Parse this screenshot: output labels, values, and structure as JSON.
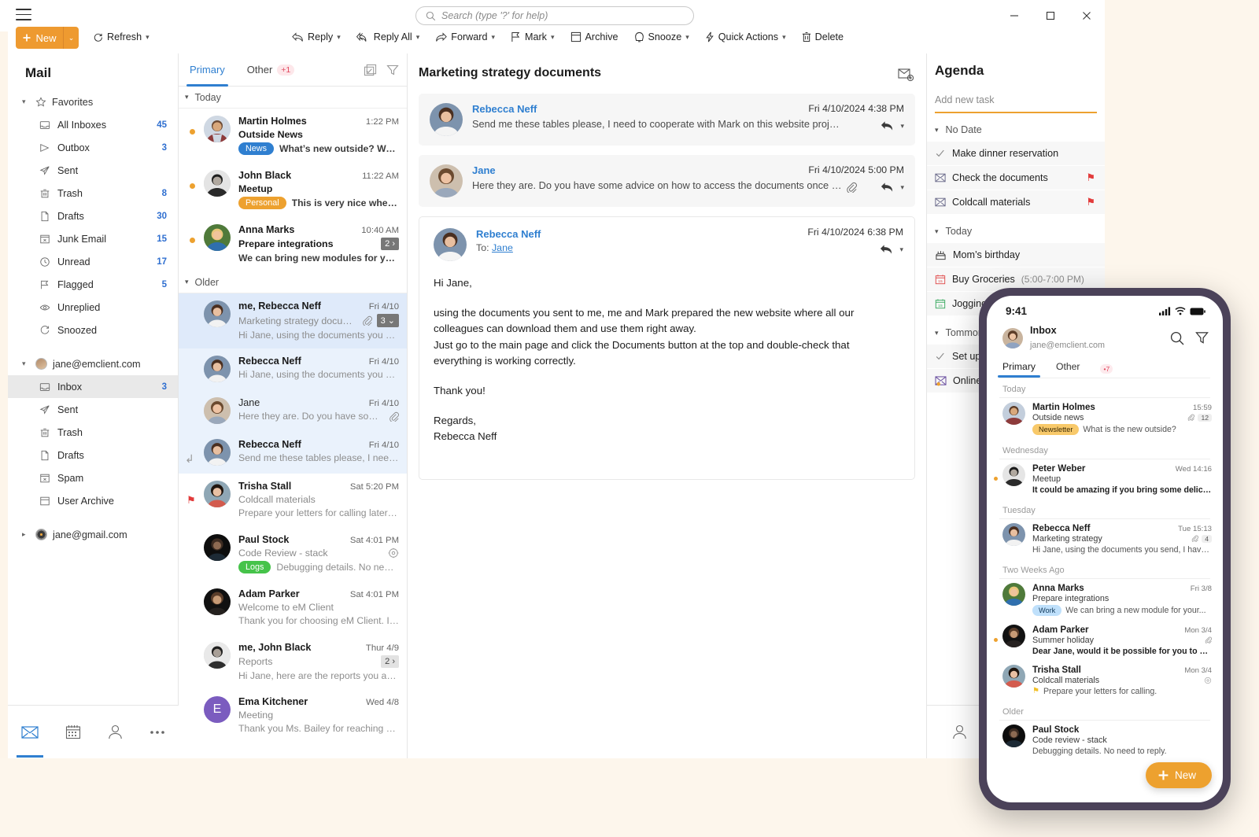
{
  "titlebar": {
    "menu_icon": "hamburger-icon",
    "search_placeholder": "Search (type '?' for help)",
    "minimize": "–",
    "maximize": "□",
    "close": "✕"
  },
  "toolbar": {
    "new_label": "New",
    "new_caret": "⌄",
    "refresh_label": "Refresh",
    "items": [
      {
        "label": "Reply",
        "icon": "reply-icon",
        "caret": true
      },
      {
        "label": "Reply All",
        "icon": "reply-all-icon",
        "caret": true
      },
      {
        "label": "Forward",
        "icon": "forward-icon",
        "caret": true
      },
      {
        "label": "Mark",
        "icon": "flag-icon",
        "caret": true
      },
      {
        "label": "Archive",
        "icon": "archive-icon",
        "caret": false
      },
      {
        "label": "Snooze",
        "icon": "snooze-icon",
        "caret": true
      },
      {
        "label": "Quick Actions",
        "icon": "lightning-icon",
        "caret": true
      },
      {
        "label": "Delete",
        "icon": "trash-icon",
        "caret": false
      }
    ]
  },
  "sidebar": {
    "title": "Mail",
    "favorites_label": "Favorites",
    "favorites": [
      {
        "label": "All Inboxes",
        "count": "45",
        "icon": "inbox-icon"
      },
      {
        "label": "Outbox",
        "count": "3",
        "icon": "outbox-icon"
      },
      {
        "label": "Sent",
        "count": "",
        "icon": "sent-icon"
      },
      {
        "label": "Trash",
        "count": "8",
        "icon": "trash-icon"
      },
      {
        "label": "Drafts",
        "count": "30",
        "icon": "drafts-icon"
      },
      {
        "label": "Junk Email",
        "count": "15",
        "icon": "junk-icon"
      },
      {
        "label": "Unread",
        "count": "17",
        "icon": "clock-icon"
      },
      {
        "label": "Flagged",
        "count": "5",
        "icon": "flag-icon"
      },
      {
        "label": "Unreplied",
        "count": "",
        "icon": "eye-icon"
      },
      {
        "label": "Snoozed",
        "count": "",
        "icon": "snooze-icon"
      }
    ],
    "account1": "jane@emclient.com",
    "account1_folders": [
      {
        "label": "Inbox",
        "count": "3",
        "icon": "inbox-icon",
        "selected": true
      },
      {
        "label": "Sent",
        "count": "",
        "icon": "sent-icon",
        "selected": false
      },
      {
        "label": "Trash",
        "count": "",
        "icon": "trash-icon",
        "selected": false
      },
      {
        "label": "Drafts",
        "count": "",
        "icon": "drafts-icon",
        "selected": false
      },
      {
        "label": "Spam",
        "count": "",
        "icon": "junk-icon",
        "selected": false
      },
      {
        "label": "User Archive",
        "count": "",
        "icon": "archive-icon",
        "selected": false
      }
    ],
    "account2": "jane@gmail.com",
    "bottom_nav": [
      "mail-icon",
      "calendar-icon",
      "contacts-icon",
      "more-icon"
    ]
  },
  "list": {
    "tab_primary": "Primary",
    "tab_other": "Other",
    "other_badge": "+1",
    "group_today": "Today",
    "group_older": "Older",
    "today": [
      {
        "from": "Martin Holmes",
        "time": "1:22 PM",
        "subject": "Outside News",
        "tag": "News",
        "tag_color": "#2f7fd0",
        "preview": "What’s new outside? We ...",
        "unread": true,
        "preview_dark": true
      },
      {
        "from": "John Black",
        "time": "11:22 AM",
        "subject": "Meetup",
        "tag": "Personal",
        "tag_color": "#eda12f",
        "preview": "This is very nice when y...",
        "unread": true,
        "preview_dark": true
      },
      {
        "from": "Anna Marks",
        "time": "10:40 AM",
        "subject": "Prepare integrations",
        "tag": "",
        "tag_color": "",
        "preview": "We can bring new modules for you...",
        "unread": true,
        "preview_dark": true,
        "count": "2 ›"
      }
    ],
    "older": [
      {
        "from": "me, Rebecca Neff",
        "time": "Fri 4/10",
        "subject": "Marketing strategy docum...",
        "preview": "Hi Jane, using the documents you se...",
        "selected": true,
        "attach": true,
        "count": "3 ⌄"
      },
      {
        "from": "Rebecca Neff",
        "time": "Fri 4/10",
        "subject": "",
        "preview": "Hi Jane, using the documents you se...",
        "thread": true
      },
      {
        "from": "Jane",
        "time": "Fri 4/10",
        "subject": "",
        "preview": "Here they are. Do you have some...",
        "thread": true,
        "attach": true,
        "light_from": true
      },
      {
        "from": "Rebecca Neff",
        "time": "Fri 4/10",
        "subject": "",
        "preview": "Send me these tables please, I need t...",
        "thread": true,
        "replied": true
      },
      {
        "from": "Trisha Stall",
        "time": "Sat 5:20 PM",
        "subject": "Coldcall materials",
        "preview": "Prepare your letters for calling later t...",
        "flagged": true
      },
      {
        "from": "Paul Stock",
        "time": "Sat 4:01 PM",
        "subject": "Code Review - stack",
        "tag": "Logs",
        "tag_color": "#46c34a",
        "preview": "Debugging details. No need ...",
        "snoozed": true
      },
      {
        "from": "Adam Parker",
        "time": "Sat 4:01 PM",
        "subject": "Welcome to eM Client",
        "preview": "Thank you for choosing eM Client. It ..."
      },
      {
        "from": "me, John Black",
        "time": "Thur 4/9",
        "subject": "Reports",
        "preview": "Hi Jane, here are the reports you ask...",
        "count": "2 ›",
        "count_light": true
      },
      {
        "from": "Ema Kitchener",
        "time": "Wed 4/8",
        "subject": "Meeting",
        "preview": "Thank you Ms. Bailey for reaching ou...",
        "initial": "E"
      }
    ]
  },
  "reading": {
    "title": "Marketing strategy documents",
    "messages": [
      {
        "from": "Rebecca Neff",
        "date": "Fri 4/10/2024 4:38 PM",
        "preview": "Send me these tables please, I need to cooperate with Mark on this website project...",
        "attach": false
      },
      {
        "from": "Jane",
        "date": "Fri 4/10/2024 5:00 PM",
        "preview": "Here they are. Do you have some advice on how to access the documents once th...",
        "attach": true
      }
    ],
    "open_message": {
      "from": "Rebecca Neff",
      "to_label": "To:",
      "to": "Jane",
      "date": "Fri 4/10/2024 6:38 PM",
      "body": [
        "Hi Jane,",
        "using the documents you sent to me, me and Mark prepared the new website where all our colleagues can download them and use them right away.\nJust go to the main page and click the Documents button at the top and double-check that everything is working correctly.",
        "Thank you!",
        "Regards,\nRebecca Neff"
      ]
    }
  },
  "agenda": {
    "title": "Agenda",
    "add_placeholder": "Add new task",
    "groups": [
      {
        "label": "No Date",
        "items": [
          {
            "text": "Make dinner reservation",
            "icon": "check-icon",
            "flag": false
          },
          {
            "text": "Check the documents",
            "icon": "envelope-task-icon",
            "flag": true
          },
          {
            "text": "Coldcall materials",
            "icon": "envelope-task-icon",
            "flag": true
          }
        ]
      },
      {
        "label": "Today",
        "items": [
          {
            "text": "Mom’s birthday",
            "sub": "",
            "icon": "birthday-icon",
            "flag": false
          },
          {
            "text": "Buy Groceries",
            "sub": "(5:00-7:00 PM)",
            "icon": "calendar-red-icon",
            "flag": false
          },
          {
            "text": "Jogging",
            "sub": "",
            "icon": "calendar-green-icon",
            "flag": false
          }
        ]
      },
      {
        "label": "Tommorow",
        "items": [
          {
            "text": "Set up",
            "sub": "",
            "icon": "check-icon",
            "flag": false
          },
          {
            "text": "Online",
            "sub": "",
            "icon": "envelope-task-icon",
            "flag": false
          }
        ]
      }
    ],
    "bottom_nav": [
      "contacts-icon"
    ]
  },
  "phone": {
    "status_time": "9:41",
    "status_icons": [
      "signal-icon",
      "wifi-icon",
      "battery-icon"
    ],
    "account_name": "Inbox",
    "account_mail": "jane@emclient.com",
    "header_icons": [
      "search-icon",
      "filter-icon"
    ],
    "tab_primary": "Primary",
    "tab_other": "Other",
    "other_badge": "•7",
    "groups": [
      {
        "label": "Today",
        "rows": [
          {
            "from": "Martin Holmes",
            "time": "15:59",
            "subject": "Outside news",
            "tag": "Newsletter",
            "tag_bg": "#f8c96a",
            "tag_color": "#3a2a06",
            "preview": "What is the new outside?",
            "attach": true,
            "count": "12",
            "unread": false,
            "bold_preview": false
          }
        ]
      },
      {
        "label": "Wednesday",
        "rows": [
          {
            "from": "Peter Weber",
            "time": "Wed 14:16",
            "subject": "Meetup",
            "preview": "It could be amazing if you bring some delicious...",
            "unread": true,
            "bold_preview": true
          }
        ]
      },
      {
        "label": "Tuesday",
        "rows": [
          {
            "from": "Rebecca Neff",
            "time": "Tue 15:13",
            "subject": "Marketing strategy",
            "preview": "Hi Jane, using the documents you send, I have m...",
            "attach": true,
            "count": "4"
          }
        ]
      },
      {
        "label": "Two Weeks Ago",
        "rows": [
          {
            "from": "Anna Marks",
            "time": "Fri 3/8",
            "subject": "Prepare integrations",
            "tag": "Work",
            "tag_bg": "#bfe0fb",
            "tag_color": "#123a5c",
            "preview": "We can bring a new module for your..."
          },
          {
            "from": "Adam Parker",
            "time": "Mon 3/4",
            "subject": "Summer holiday",
            "preview": "Dear Jane, would it be possible for you to be i...",
            "unread": true,
            "bold_preview": true,
            "attach": true
          },
          {
            "from": "Trisha Stall",
            "time": "Mon 3/4",
            "subject": "Coldcall materials",
            "preview": "Prepare your letters for calling.",
            "snoozed": true,
            "flag": true
          }
        ]
      },
      {
        "label": "Older",
        "rows": [
          {
            "from": "Paul Stock",
            "time": "",
            "subject": "Code review - stack",
            "preview": "Debugging details. No need to reply."
          }
        ]
      }
    ],
    "new_button": "New"
  },
  "colors": {
    "accent_orange": "#eda12f",
    "accent_blue": "#2f7fd0",
    "flag_red": "#e23b3b",
    "phone_frame": "#4b4259"
  }
}
